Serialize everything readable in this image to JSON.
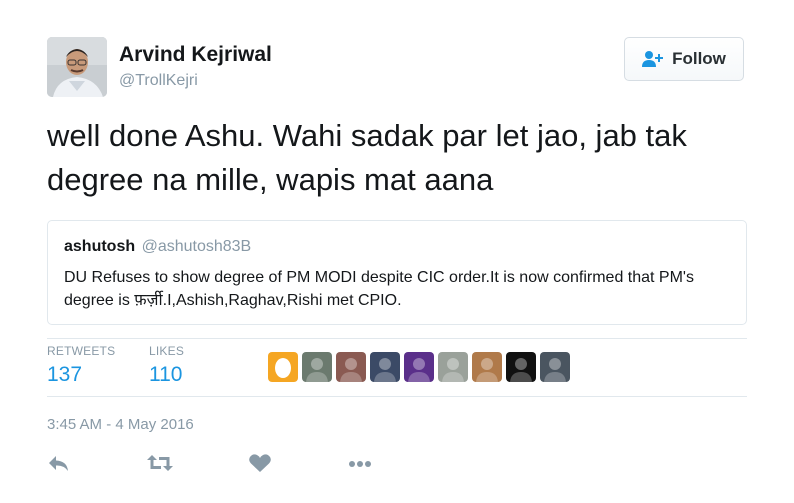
{
  "author": {
    "name": "Arvind Kejriwal",
    "handle": "@TrollKejri"
  },
  "follow_button": {
    "label": "Follow",
    "icon": "add-user-icon"
  },
  "tweet": {
    "text": "well done Ashu. Wahi sadak par let jao, jab tak degree na mille, wapis mat aana"
  },
  "quoted_tweet": {
    "name": "ashutosh",
    "handle": "@ashutosh83B",
    "text": "DU Refuses to show degree of PM MODI despite CIC order.It is now confirmed that PM's degree is फ़र्ज़ी.I,Ashish,Raghav,Rishi met CPIO."
  },
  "stats": {
    "retweets_label": "RETWEETS",
    "retweets_value": "137",
    "likes_label": "LIKES",
    "likes_value": "110"
  },
  "likers": [
    {
      "icon": "egg-avatar",
      "color": "#f5a623"
    },
    {
      "icon": "user-avatar",
      "color": "#6b7a6e"
    },
    {
      "icon": "user-avatar",
      "color": "#8a5a52"
    },
    {
      "icon": "user-avatar",
      "color": "#3b4a66"
    },
    {
      "icon": "user-avatar",
      "color": "#5a2f8a"
    },
    {
      "icon": "user-avatar",
      "color": "#9aa19a"
    },
    {
      "icon": "user-avatar",
      "color": "#b07a4a"
    },
    {
      "icon": "user-avatar",
      "color": "#111111"
    },
    {
      "icon": "user-avatar",
      "color": "#4a5560"
    }
  ],
  "timestamp": "3:45 AM - 4 May 2016",
  "actions": [
    {
      "icon": "reply-icon"
    },
    {
      "icon": "retweet-icon"
    },
    {
      "icon": "like-icon"
    },
    {
      "icon": "more-icon"
    }
  ],
  "colors": {
    "link_blue": "#1b95e0",
    "muted_gray": "#8899a6",
    "text_dark": "#14171a",
    "border": "#e1e8ed"
  }
}
